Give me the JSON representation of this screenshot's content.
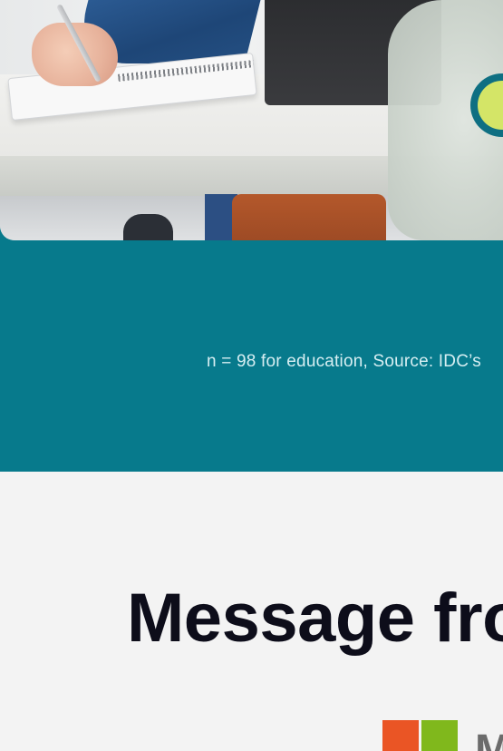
{
  "source_note": "n = 98 for education, Source: IDC’s",
  "heading": "Message fro",
  "logo": {
    "wordmark_fragment": "M",
    "square_colors": [
      "#ea5525",
      "#80b81c"
    ]
  },
  "colors": {
    "teal_band": "#077a8c",
    "badge_ring": "#0e6f82",
    "badge_fill": "#d4e567",
    "page_background": "#f3f3f3"
  }
}
